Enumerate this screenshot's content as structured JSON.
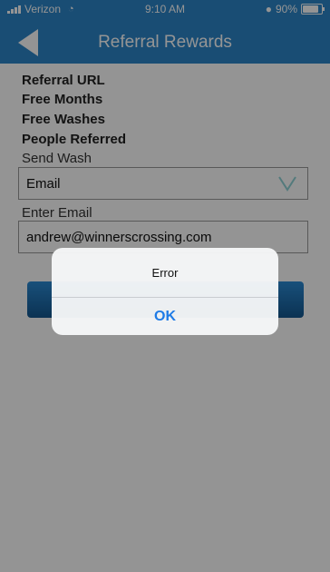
{
  "status_bar": {
    "carrier": "Verizon",
    "time": "9:10 AM",
    "battery": "90%"
  },
  "nav": {
    "title": "Referral Rewards",
    "back_icon": "back-arrow-icon"
  },
  "info": {
    "referral_url": "Referral URL",
    "free_months": "Free Months",
    "free_washes": "Free Washes",
    "people_referred": "People Referred"
  },
  "send_wash": {
    "label": "Send Wash",
    "selected": "Email",
    "arrow_icon": "chevron-down-icon"
  },
  "email": {
    "label": "Enter Email",
    "value": "andrew@winnerscrossing.com"
  },
  "alert": {
    "title": "Error",
    "ok_label": "OK"
  },
  "colors": {
    "header": "#2c86c9",
    "ok": "#1e7be6"
  }
}
